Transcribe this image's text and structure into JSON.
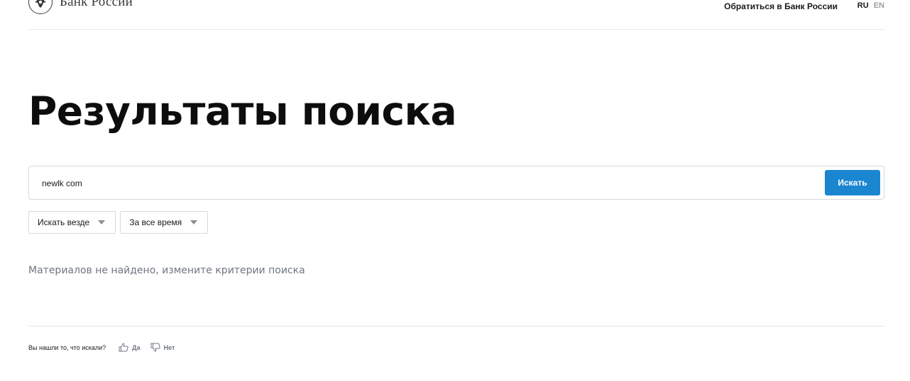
{
  "header": {
    "logo_text": "Банк России",
    "contact_link": "Обратиться в Банк России",
    "languages": [
      "RU",
      "EN"
    ]
  },
  "main": {
    "title": "Результаты поиска",
    "search": {
      "value": "newlk com",
      "button_label": "Искать"
    },
    "filters": [
      {
        "selected": "Искать везде"
      },
      {
        "selected": "За все время"
      }
    ],
    "no_results_text": "Материалов не найдено, измените критерии поиска"
  },
  "feedback": {
    "question": "Вы нашли то, что искали?",
    "yes_label": "Да",
    "no_label": "Нет"
  },
  "colors": {
    "accent": "#1a86d0",
    "muted_text": "#6f7680"
  },
  "icons": {
    "logo": "emblem-eagle-icon",
    "filter_caret": "caret-down-icon",
    "yes": "thumbs-up-icon",
    "no": "thumbs-down-icon"
  }
}
